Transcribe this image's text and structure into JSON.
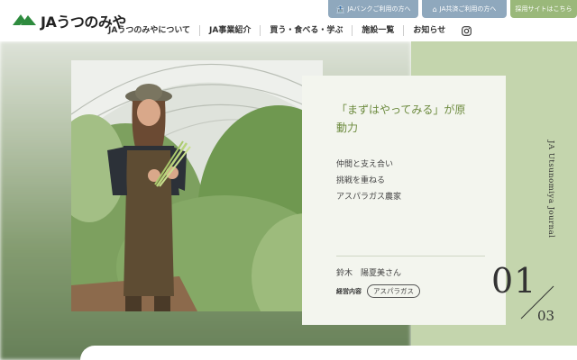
{
  "header": {
    "logo_text": "JAうつのみや",
    "top_buttons": [
      {
        "label": "JAバンクご利用の方へ",
        "icon": "bank-icon"
      },
      {
        "label": "JA共済ご利用の方へ",
        "icon": "house-icon"
      },
      {
        "label": "採用サイトはこちら",
        "icon": ""
      }
    ],
    "nav": [
      {
        "label": "JAうつのみやについて"
      },
      {
        "label": "JA事業紹介"
      },
      {
        "label": "買う・食べる・学ぶ"
      },
      {
        "label": "施設一覧"
      },
      {
        "label": "お知らせ"
      }
    ],
    "social_icon": "instagram-icon"
  },
  "hero": {
    "headline": "「まずはやってみる」が原動力",
    "sub_lines": [
      "仲間と支え合い",
      "挑戦を重ねる",
      "アスパラガス農家"
    ],
    "person_name": "鈴木　陽夏美さん",
    "business_label": "経営内容",
    "business_tag": "アスパラガス",
    "journal_label": "JA Utsunomiya Journal",
    "page_current": "01",
    "page_total": "03"
  },
  "colors": {
    "brand_green": "#2e8b3e",
    "headline_green": "#6d8b3f",
    "panel_green": "#c4d5ad",
    "button_blue": "#8fa8bd",
    "button_green": "#9ab87a"
  }
}
